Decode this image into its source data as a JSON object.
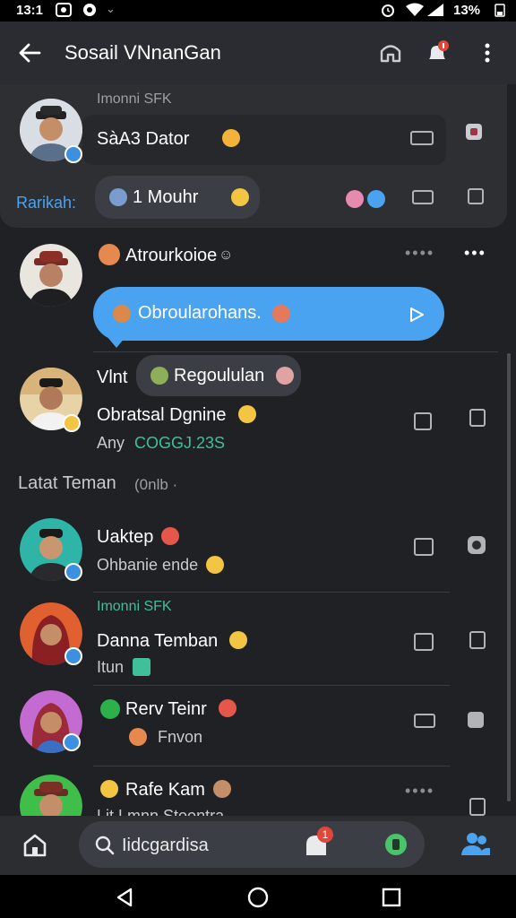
{
  "status_bar": {
    "time": "13:1",
    "battery": "13%"
  },
  "header": {
    "title": "Sosail VNnanGan"
  },
  "pinned": {
    "meta": "Imonni SFK",
    "message": "SàA3 Dator",
    "label": "Rarikah:",
    "chip": "1 Mouhr"
  },
  "chat1": {
    "name": "Atrourkoioe",
    "bubble": "Obroularohans."
  },
  "chat2": {
    "prefix": "Vlnt",
    "chip": "Regoululan",
    "title": "Obratsal Dgnine",
    "sub_label": "Any",
    "sub_value": "COGGJ.23S"
  },
  "section": {
    "title": "Latat Teman",
    "suffix": "(0nlb ·"
  },
  "friends": [
    {
      "name": "Uaktep",
      "sub": "Ohbanie ende"
    },
    {
      "meta": "Imonni SFK",
      "name": "Danna Temban",
      "sub": "Itun"
    },
    {
      "name": "Rerv Teinr",
      "sub": "Fnvon"
    },
    {
      "name": "Rafe Kam",
      "sub": "Lit Lmnn Stoontra"
    }
  ],
  "search": {
    "placeholder": "Iidcgardisa",
    "badge": "1"
  },
  "colors": {
    "accent": "#4aa3f0",
    "appbar": "#2a2c31",
    "background": "#202124",
    "highlight": "#2d2f33"
  }
}
